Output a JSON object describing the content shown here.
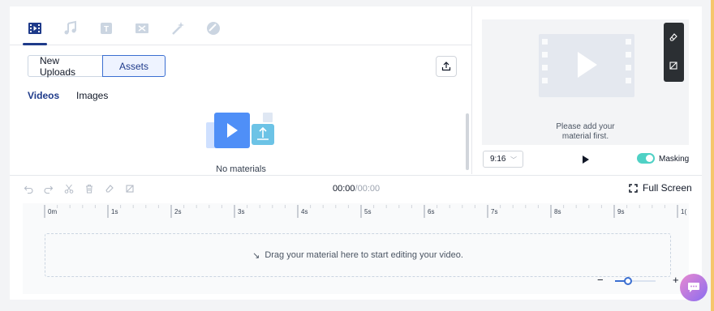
{
  "tabs": [
    {
      "name": "video-tab",
      "icon": "video-icon",
      "active": true
    },
    {
      "name": "music-tab",
      "icon": "music-note-icon",
      "active": false
    },
    {
      "name": "text-tab",
      "icon": "text-icon",
      "active": false
    },
    {
      "name": "transition-tab",
      "icon": "transition-icon",
      "active": false
    },
    {
      "name": "effects-tab",
      "icon": "magic-wand-icon",
      "active": false
    },
    {
      "name": "sticker-tab",
      "icon": "sticker-icon",
      "active": false
    }
  ],
  "media": {
    "new_uploads_label": "New Uploads",
    "assets_label": "Assets",
    "videos_label": "Videos",
    "images_label": "Images",
    "empty_text": "No materials"
  },
  "preview": {
    "message": "Please add your material first.",
    "ratio": "9:16",
    "masking_label": "Masking",
    "masking_on": true
  },
  "timeline": {
    "current_time": "00:00",
    "total_time": "/00:00",
    "fullscreen_label": "Full Screen",
    "ticks": [
      "0m",
      "1s",
      "2s",
      "3s",
      "4s",
      "5s",
      "6s",
      "7s",
      "8s",
      "9s",
      "1("
    ],
    "drop_text": "Drag your material here to start editing your video.",
    "zoom_minus": "−",
    "zoom_plus": "+"
  },
  "colors": {
    "accent": "#1e3a8a",
    "toggle": "#4fd1c5",
    "toolbar_dark": "#2b2f33"
  }
}
